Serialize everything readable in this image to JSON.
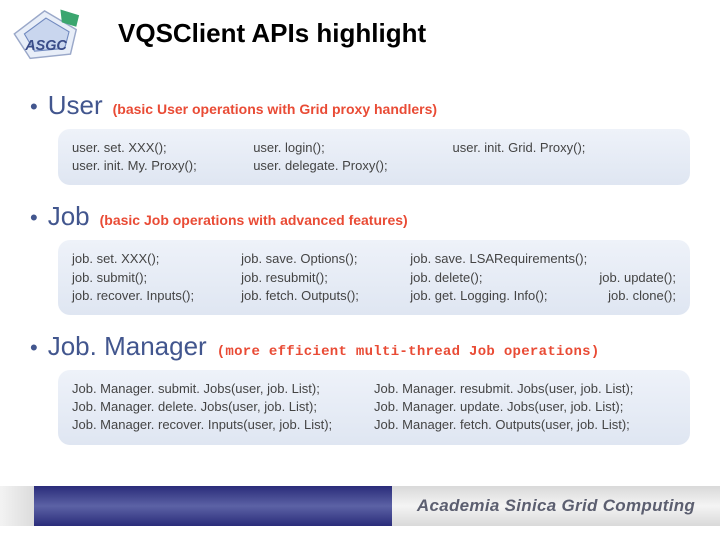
{
  "title": "VQSClient APIs highlight",
  "sections": {
    "user": {
      "name": "User",
      "desc": "(basic User operations with Grid proxy handlers)",
      "cols": [
        [
          "user. set. XXX();",
          "user. init. My. Proxy();"
        ],
        [
          "user. login();",
          "user. delegate. Proxy();"
        ],
        [
          "user. init. Grid. Proxy();"
        ]
      ]
    },
    "job": {
      "name": "Job",
      "desc": "(basic Job operations with advanced features)",
      "cols": [
        [
          "job. set. XXX();",
          "job. submit();",
          "job. recover. Inputs();"
        ],
        [
          "job. save. Options();",
          "job. resubmit();",
          "job. fetch. Outputs();"
        ],
        [
          {
            "single": "job. save. LSARequirements();"
          },
          {
            "pair": [
              "job. delete();",
              "job. update();"
            ]
          },
          {
            "pair": [
              "job. get. Logging. Info();",
              "job. clone();"
            ]
          }
        ]
      ]
    },
    "jobManager": {
      "name": "Job. Manager",
      "desc": "(more efficient multi-thread Job operations)",
      "cols": [
        [
          "Job. Manager. submit. Jobs(user, job. List);",
          "Job. Manager. delete. Jobs(user, job. List);",
          "Job. Manager. recover. Inputs(user, job. List);"
        ],
        [
          "Job. Manager. resubmit. Jobs(user, job. List);",
          "Job. Manager. update. Jobs(user, job. List);",
          "Job. Manager. fetch. Outputs(user, job. List);"
        ]
      ]
    }
  },
  "footer": "Academia Sinica Grid Computing",
  "logo_text": "ASGC"
}
